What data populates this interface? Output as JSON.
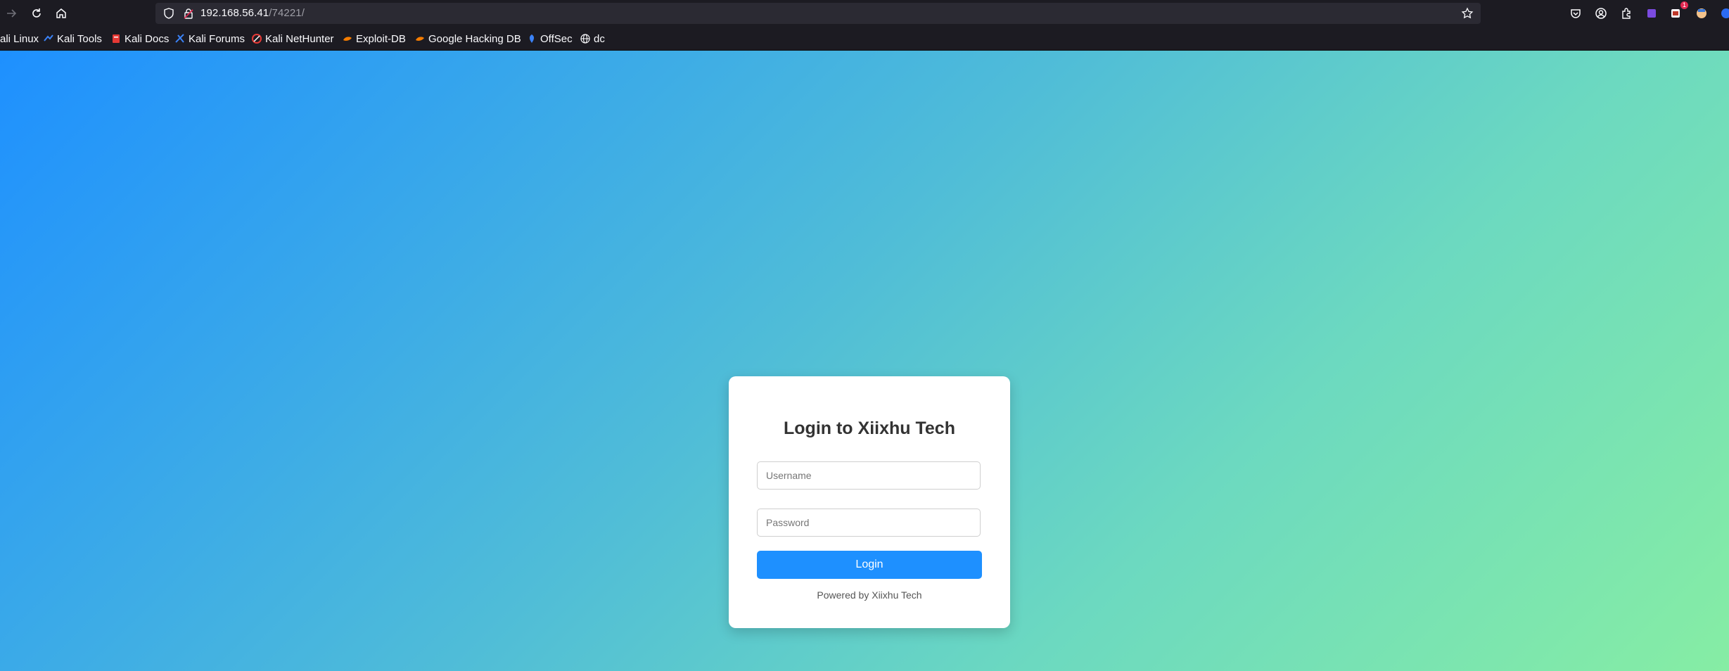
{
  "browser": {
    "url_host": "192.168.56.41",
    "url_path": "/74221/",
    "extension_badges": {
      "ext2": "1"
    }
  },
  "bookmarks": [
    {
      "label": "ali Linux",
      "icon": "kali-icon"
    },
    {
      "label": "Kali Tools",
      "icon": "kali-tools-icon"
    },
    {
      "label": "Kali Docs",
      "icon": "kali-docs-icon"
    },
    {
      "label": "Kali Forums",
      "icon": "kali-forums-icon"
    },
    {
      "label": "Kali NetHunter",
      "icon": "nethunter-icon"
    },
    {
      "label": "Exploit-DB",
      "icon": "exploit-db-icon"
    },
    {
      "label": "Google Hacking DB",
      "icon": "ghdb-icon"
    },
    {
      "label": "OffSec",
      "icon": "offsec-icon"
    },
    {
      "label": "dc",
      "icon": "globe-icon"
    }
  ],
  "login": {
    "title": "Login to Xiixhu Tech",
    "username_placeholder": "Username",
    "password_placeholder": "Password",
    "button_label": "Login",
    "footer": "Powered by Xiixhu Tech"
  },
  "colors": {
    "accent": "#1e90ff",
    "gradient_start": "#1e90ff",
    "gradient_end": "#86eda4"
  }
}
